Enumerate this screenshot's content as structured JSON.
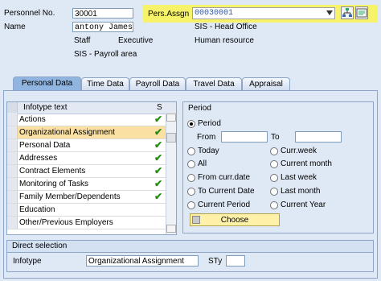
{
  "header": {
    "personnel_no_label": "Personnel No.",
    "personnel_no_value": "30001",
    "name_label": "Name",
    "name_value": "antony James",
    "pers_assgn_label": "Pers.Assgn",
    "pers_assgn_value": "00030001",
    "info": {
      "staff": "Staff",
      "executive": "Executive",
      "sis_head_office": "SIS - Head Office",
      "human_resource": "Human resource",
      "sis_payroll_area": "SIS - Payroll area"
    }
  },
  "tabs": [
    "Personal Data",
    "Time Data",
    "Payroll Data",
    "Travel Data",
    "Appraisal"
  ],
  "infotype_table": {
    "col_text": "Infotype text",
    "col_s": "S",
    "rows": [
      {
        "text": "Actions",
        "check": "✔"
      },
      {
        "text": "Organizational Assignment",
        "check": "✔"
      },
      {
        "text": "Personal Data",
        "check": "✔"
      },
      {
        "text": "Addresses",
        "check": "✔"
      },
      {
        "text": "Contract Elements",
        "check": "✔"
      },
      {
        "text": "Monitoring of Tasks",
        "check": "✔"
      },
      {
        "text": "Family Member/Dependents",
        "check": "✔"
      },
      {
        "text": "Education",
        "check": ""
      },
      {
        "text": "Other/Previous Employers",
        "check": ""
      }
    ]
  },
  "period": {
    "title": "Period",
    "period_label": "Period",
    "from_label": "From",
    "to_label": "To",
    "options": {
      "today": "Today",
      "all": "All",
      "from_curr_date": "From curr.date",
      "to_current_date": "To Current Date",
      "current_period": "Current Period",
      "curr_week": "Curr.week",
      "current_month": "Current month",
      "last_week": "Last week",
      "last_month": "Last month",
      "current_year": "Current Year"
    },
    "choose_label": "Choose"
  },
  "direct_selection": {
    "title": "Direct selection",
    "infotype_label": "Infotype",
    "infotype_value": "Organizational Assignment",
    "sty_label": "STy",
    "sty_value": ""
  },
  "colors": {
    "highlight": "#f6f36a",
    "selected_row": "#fbe0a4",
    "check": "#2b8a12",
    "choose_button": "#fff1a8"
  }
}
